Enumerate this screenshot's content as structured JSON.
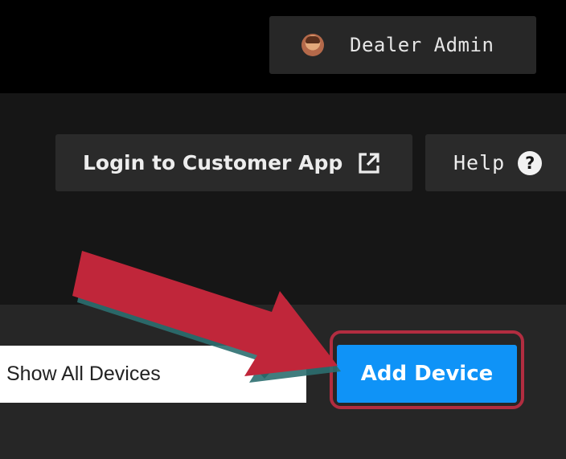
{
  "top_bar": {
    "user_menu": {
      "name": "Dealer Admin",
      "avatar_icon": "user-avatar"
    }
  },
  "header": {
    "login_button": {
      "label": "Login to Customer App",
      "icon": "external-link-icon"
    },
    "help_button": {
      "label": "Help",
      "icon_glyph": "?"
    }
  },
  "toolbar": {
    "device_filter": {
      "selected": "Show All Devices",
      "icon": "caret-down-icon"
    },
    "add_device_button": {
      "label": "Add Device",
      "color": "#0f93f7"
    }
  },
  "annotation": {
    "arrow_color": "#c0263a",
    "highlight_color": "#b22d40"
  },
  "colors": {
    "top_bar_bg": "#000000",
    "header_bg": "#161616",
    "content_bg": "#262626",
    "dark_button_bg": "#2a2a2a"
  }
}
